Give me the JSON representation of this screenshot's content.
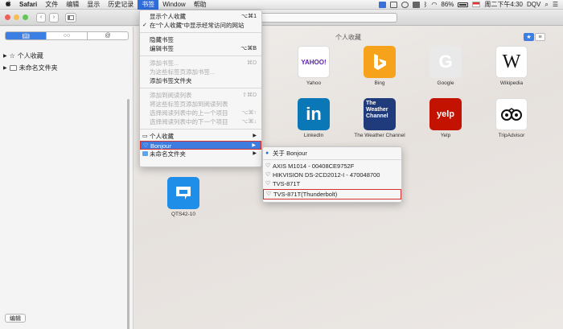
{
  "menubar": {
    "apple": "",
    "items": [
      "Safari",
      "文件",
      "编辑",
      "显示",
      "历史记录",
      "书签",
      "Window",
      "帮助"
    ],
    "status": {
      "battery": "86%",
      "clock": "周二下午4:30",
      "user": "DQV"
    }
  },
  "sidebar": {
    "tabs": [
      "",
      "",
      "@"
    ],
    "items": [
      "个人收藏",
      "未命名文件夹"
    ],
    "edit_label": "编辑"
  },
  "content": {
    "title": "个人收藏",
    "tiles": [
      {
        "label": "Yahoo",
        "logo": "YAHOO!"
      },
      {
        "label": "Bing",
        "logo": ""
      },
      {
        "label": "Google",
        "logo": "G"
      },
      {
        "label": "Wikipedia",
        "logo": "W"
      },
      {
        "label": "LinkedIn",
        "logo": "in"
      },
      {
        "label": "The Weather Channel",
        "logo": "The Weather Channel"
      },
      {
        "label": "Yelp",
        "logo": "yelp"
      },
      {
        "label": "TripAdvisor",
        "logo": ""
      },
      {
        "label": "QTS42-10",
        "logo": ""
      }
    ]
  },
  "bookmarks_menu": {
    "items": [
      {
        "label": "显示个人收藏",
        "shortcut": "⌥⌘1"
      },
      {
        "label": "在“个人收藏”中显示经常访问的网站",
        "shortcut": ""
      },
      {
        "label": "隐藏书签",
        "shortcut": ""
      },
      {
        "label": "编辑书签",
        "shortcut": "⌥⌘B"
      },
      {
        "label": "添加书签...",
        "shortcut": "⌘D"
      },
      {
        "label": "为这些标签页添加书签...",
        "shortcut": ""
      },
      {
        "label": "添加书签文件夹",
        "shortcut": ""
      },
      {
        "label": "添加到阅读列表",
        "shortcut": "⇧⌘D"
      },
      {
        "label": "将这些标签页添加到阅读列表",
        "shortcut": ""
      },
      {
        "label": "选择阅读列表中的上一个项目",
        "shortcut": "⌥⌘↑"
      },
      {
        "label": "选择阅读列表中的下一个项目",
        "shortcut": "⌥⌘↓"
      },
      {
        "label": "个人收藏",
        "shortcut": ""
      },
      {
        "label": "Bonjour",
        "shortcut": ""
      },
      {
        "label": "未命名文件夹",
        "shortcut": ""
      }
    ]
  },
  "bonjour_menu": {
    "items": [
      "关于 Bonjour",
      "AXIS M1014 - 00408CE9752F",
      "HIKVISION DS-2CD2012-I - 470048700",
      "TVS-871T",
      "TVS-871T(Thunderbolt)"
    ]
  },
  "colors": {
    "accent": "#3b7fe4",
    "highlight_box": "#d63030"
  }
}
